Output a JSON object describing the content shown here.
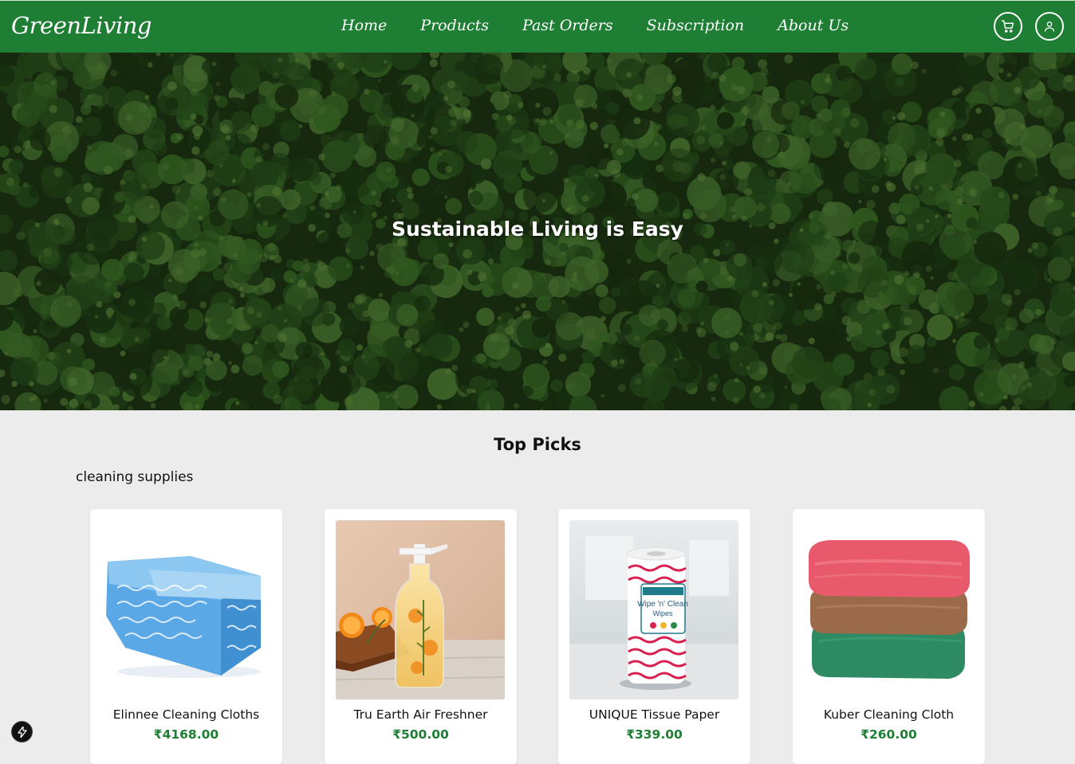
{
  "brand": {
    "logo": "GreenLiving",
    "primary_color": "#1e7e34"
  },
  "nav": {
    "links": [
      "Home",
      "Products",
      "Past Orders",
      "Subscription",
      "About Us"
    ],
    "icons": [
      "cart-icon",
      "user-icon"
    ]
  },
  "hero": {
    "title": "Sustainable Living is Easy"
  },
  "top_picks": {
    "title": "Top Picks",
    "category": "cleaning supplies",
    "products": [
      {
        "name": "Elinnee Cleaning Cloths",
        "price": "₹4168.00",
        "image": "blue-cleaning-cloths"
      },
      {
        "name": "Tru Earth Air Freshner",
        "price": "₹500.00",
        "image": "spray-bottle-oranges"
      },
      {
        "name": "UNIQUE Tissue Paper",
        "price": "₹339.00",
        "image": "wipes-roll"
      },
      {
        "name": "Kuber Cleaning Cloth",
        "price": "₹260.00",
        "image": "stacked-towels"
      }
    ]
  },
  "dev_badge_icon": "lightning-icon"
}
